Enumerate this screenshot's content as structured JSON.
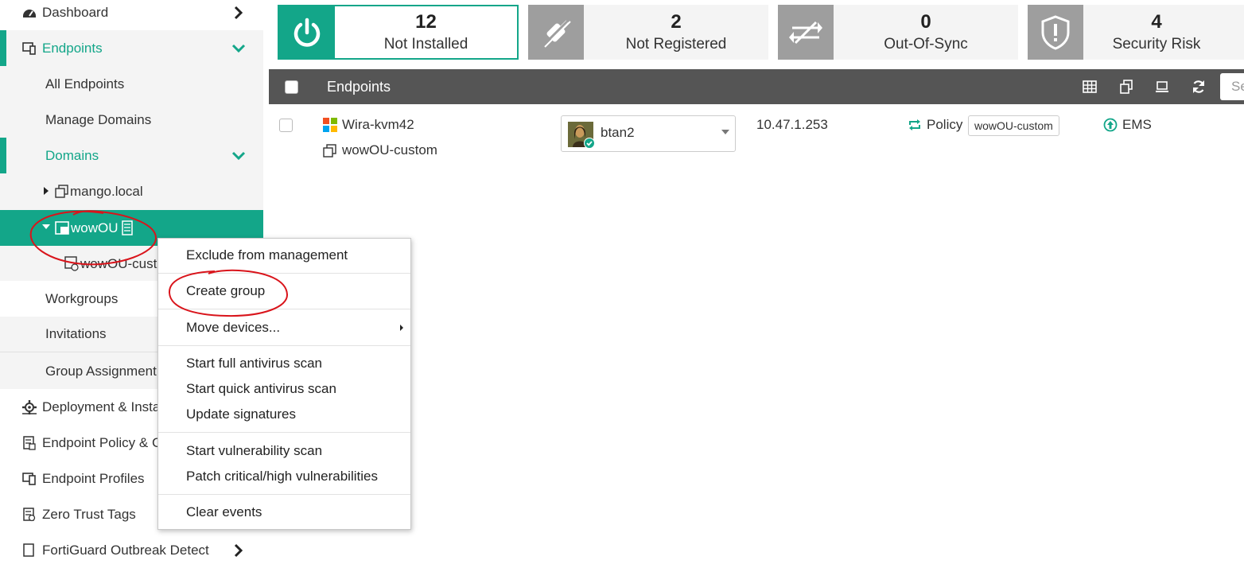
{
  "sidebar": {
    "dashboard": "Dashboard",
    "endpoints": "Endpoints",
    "all_endpoints": "All Endpoints",
    "manage_domains": "Manage Domains",
    "domains": "Domains",
    "mango_local": "mango.local",
    "wowou": "wowOU",
    "wowou_custom": "wowOU-cust",
    "workgroups": "Workgroups",
    "invitations": "Invitations",
    "group_assignment": "Group Assignment",
    "deployment": "Deployment & Insta",
    "endpoint_policy": "Endpoint Policy & C",
    "endpoint_profiles": "Endpoint Profiles",
    "zero_trust_tags": "Zero Trust Tags",
    "fortiguard": "FortiGuard Outbreak Detect"
  },
  "stats": [
    {
      "count": "12",
      "label": "Not Installed",
      "icon": "power-icon"
    },
    {
      "count": "2",
      "label": "Not Registered",
      "icon": "unplugged-icon"
    },
    {
      "count": "0",
      "label": "Out-Of-Sync",
      "icon": "out-of-sync-icon"
    },
    {
      "count": "4",
      "label": "Security Risk",
      "icon": "shield-alert-icon"
    }
  ],
  "table": {
    "header_title": "Endpoints",
    "search_placeholder": "Se",
    "row": {
      "hostname": "Wira-kvm42",
      "group": "wowOU-custom",
      "user": "btan2",
      "ip": "10.47.1.253",
      "policy_label": "Policy",
      "policy_tag": "wowOU-custom",
      "managed_by": "EMS"
    }
  },
  "context_menu": {
    "exclude": "Exclude from management",
    "create_group": "Create group",
    "move_devices": "Move devices...",
    "full_scan": "Start full antivirus scan",
    "quick_scan": "Start quick antivirus scan",
    "update_signatures": "Update signatures",
    "vuln_scan": "Start vulnerability scan",
    "patch": "Patch critical/high vulnerabilities",
    "clear_events": "Clear events"
  },
  "colors": {
    "accent": "#13a689",
    "header_bg": "#555555",
    "annotation": "#d9141b"
  }
}
